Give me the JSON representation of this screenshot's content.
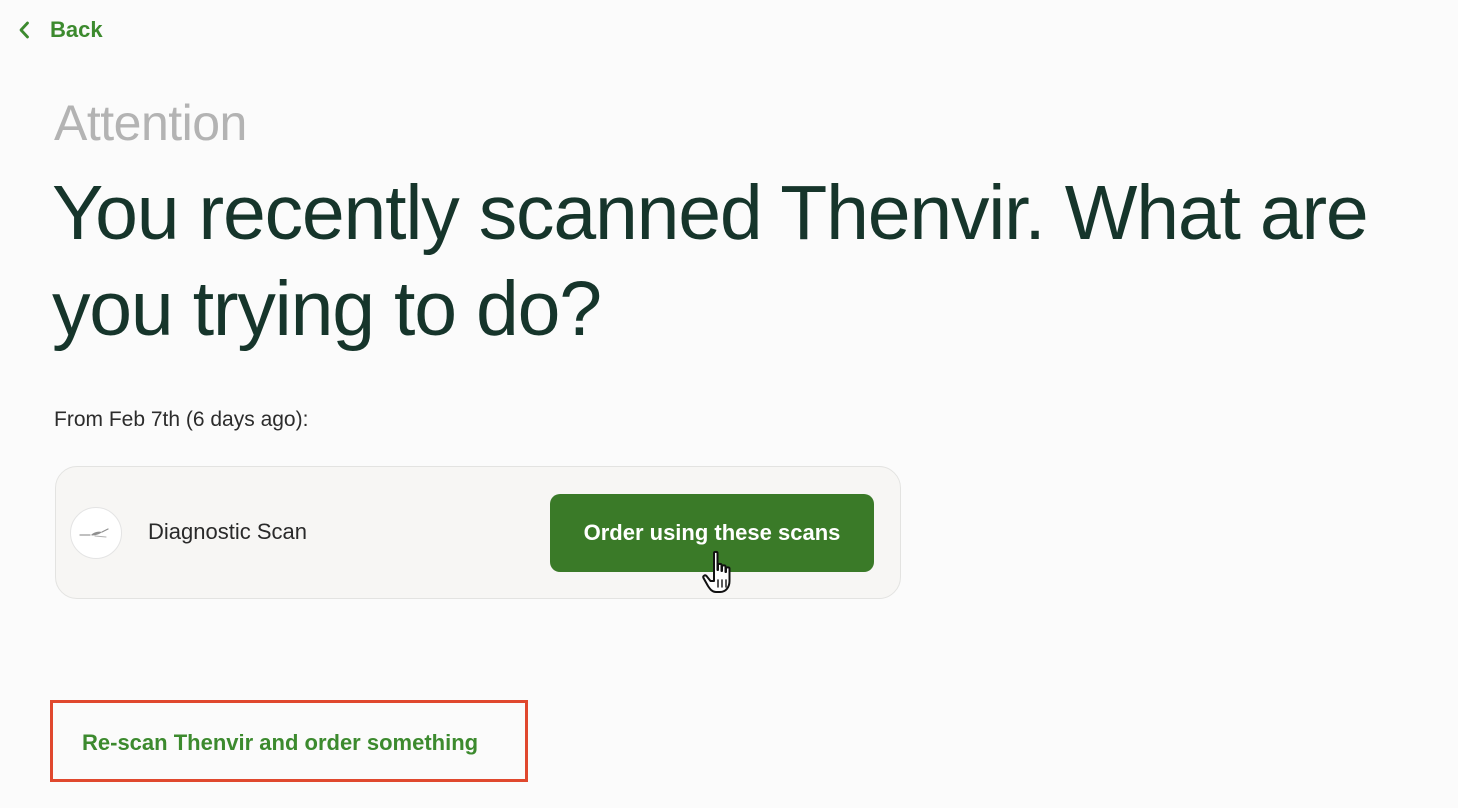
{
  "nav": {
    "back_label": "Back"
  },
  "header": {
    "eyebrow": "Attention",
    "title": "You recently scanned Thenvir. What are you trying to do?"
  },
  "scans": {
    "from_label": "From Feb 7th (6 days ago):",
    "items": [
      {
        "icon": "scan-thumbnail-icon",
        "name": "Diagnostic Scan",
        "action_label": "Order using these scans"
      }
    ]
  },
  "footer": {
    "rescan_label": "Re-scan Thenvir and order something"
  },
  "colors": {
    "accent_green": "#3c8a2e",
    "button_green": "#3a7a28",
    "title_text": "#16352b",
    "eyebrow_text": "#b3b3b3",
    "highlight_border": "#e0482e"
  }
}
